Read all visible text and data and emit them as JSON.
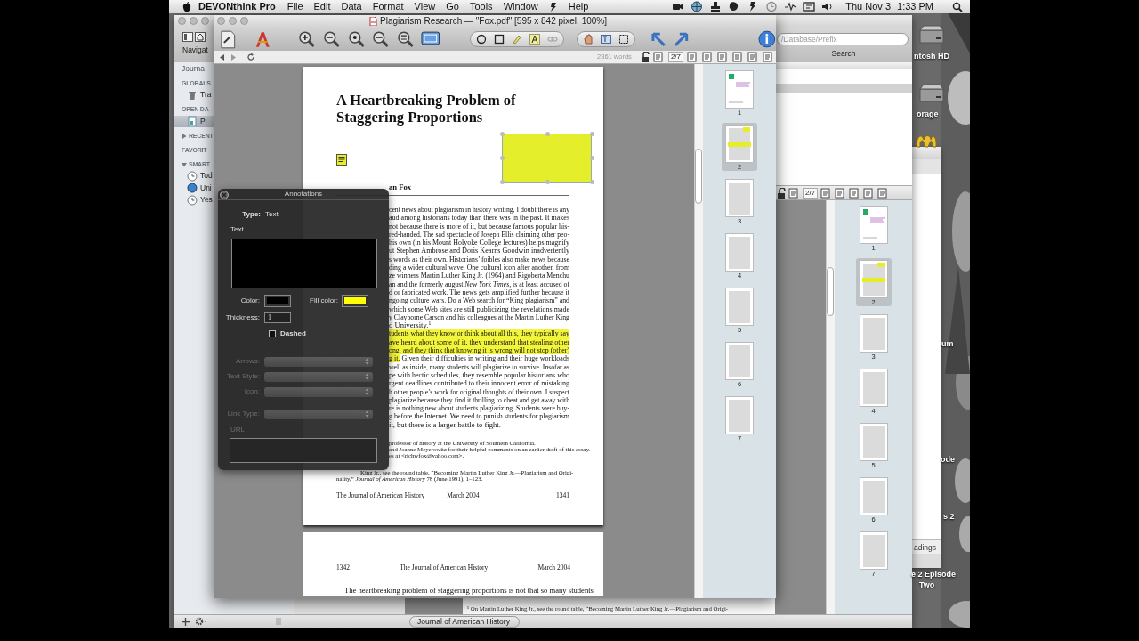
{
  "menu_bar": {
    "app_name": "DEVONthink Pro",
    "menus": [
      "File",
      "Edit",
      "Data",
      "Format",
      "View",
      "Go",
      "Tools",
      "Window",
      "Help"
    ],
    "date": "Thu Nov 3",
    "time": "1:33 PM"
  },
  "main_window": {
    "toolbar_label": "Navigat",
    "search": {
      "placeholder": "/Database/Prefix",
      "label": "Search"
    },
    "sidebar": [
      {
        "kind": "tab",
        "label": "Journa"
      },
      {
        "kind": "section",
        "label": "GLOBALS"
      },
      {
        "kind": "trash",
        "label": "Tra",
        "selected": false
      },
      {
        "kind": "section",
        "label": "OPEN DA"
      },
      {
        "kind": "database",
        "label": "Pl",
        "selected": true
      },
      {
        "kind": "section",
        "label": "RECENT",
        "expanded": false
      },
      {
        "kind": "section",
        "label": "FAVORIT"
      },
      {
        "kind": "section",
        "label": "SMART",
        "expanded": true
      },
      {
        "kind": "clock",
        "label": "Tod",
        "selected": false
      },
      {
        "kind": "unread",
        "label": "Uni",
        "selected": false
      },
      {
        "kind": "clock",
        "label": "Yes",
        "selected": false
      }
    ],
    "page_indicator": "2/7",
    "thumbnails": [
      {
        "label": "1",
        "kind": "cover",
        "selected": false
      },
      {
        "label": "2",
        "kind": "annotated",
        "selected": true
      },
      {
        "label": "3",
        "kind": "text",
        "selected": false
      },
      {
        "label": "4",
        "kind": "text",
        "selected": false
      },
      {
        "label": "5",
        "kind": "text",
        "selected": false
      },
      {
        "label": "6",
        "kind": "text",
        "selected": false
      },
      {
        "label": "7",
        "kind": "text",
        "selected": false
      }
    ],
    "preview_footnote": "¹ On Martin Luther King Jr., see the round table, “Becoming Martin Luther King Jr.—Plagiarism and Origi-",
    "tag": "Journal of American History"
  },
  "document_window": {
    "title": "Plagiarism Research — \"Fox.pdf\" [595 x 842 pixel, 100%]",
    "word_count": "2361 words",
    "page_indicator": "2/7",
    "page": {
      "title_lines": [
        "A Heartbreaking Problem of",
        "Staggering Proportions"
      ],
      "author": "an Fox",
      "body_lines": [
        {
          "segments": [
            {
              "text": "cent news about plagiarism in history writing, I doubt there is any",
              "highlighted": false
            }
          ]
        },
        {
          "segments": [
            {
              "text": "aud among historians today than there was in the past. It makes",
              "highlighted": false
            }
          ]
        },
        {
          "segments": [
            {
              "text": "not because there is more of it, but because famous popular his-",
              "highlighted": false
            }
          ]
        },
        {
          "segments": [
            {
              "text": "red-handed. The sad spectacle of Joseph Ellis claiming other peo-",
              "highlighted": false
            }
          ]
        },
        {
          "segments": [
            {
              "text": "his own (in his Mount Holyoke College lectures) helps magnify",
              "highlighted": false
            }
          ]
        },
        {
          "segments": [
            {
              "text": "ut Stephen Ambrose and Doris Kearns Goodwin inadvertently",
              "highlighted": false
            }
          ]
        },
        {
          "segments": [
            {
              "text": "s words as their own. Historians’ foibles also make news because",
              "highlighted": false
            }
          ]
        },
        {
          "segments": [
            {
              "text": "ding a wider cultural wave. One cultural icon after another, from",
              "highlighted": false
            }
          ]
        },
        {
          "segments": [
            {
              "text": "ze winners Martin Luther King Jr. (1964) and Rigoberta Menchu",
              "highlighted": false
            }
          ]
        },
        {
          "segments": [
            {
              "text": "an and the formerly august *New York Times,* is at least accused of",
              "highlighted": false
            }
          ]
        },
        {
          "segments": [
            {
              "text": "d or fabricated work. The news gets amplified further because it",
              "highlighted": false
            }
          ]
        },
        {
          "segments": [
            {
              "text": "ngoing culture wars. Do a Web search for “King plagiarism” and",
              "highlighted": false
            }
          ]
        },
        {
          "segments": [
            {
              "text": "which some Web sites are still publicizing the revelations made",
              "highlighted": false
            }
          ]
        },
        {
          "segments": [
            {
              "text": "y Clayborne Carson and his colleagues at the Martin Luther King",
              "highlighted": false
            }
          ]
        },
        {
          "segments": [
            {
              "text": "d University.$^{1}$",
              "highlighted": false
            }
          ]
        },
        {
          "segments": [
            {
              "text": "tudents what they know or think about all this, they typically say",
              "highlighted": true
            }
          ]
        },
        {
          "segments": [
            {
              "text": "ave heard about some of it, they understand that stealing other",
              "highlighted": true
            }
          ]
        },
        {
          "segments": [
            {
              "text": "ong, and they think that knowing it is wrong will not stop (other)",
              "highlighted": true
            }
          ]
        },
        {
          "segments": [
            {
              "text": "g it.",
              "highlighted": true
            },
            {
              "text": " Given their difficulties in writing and their huge workloads",
              "highlighted": false
            }
          ]
        },
        {
          "segments": [
            {
              "text": "well as inside, many students will plagiarize to survive. Insofar as",
              "highlighted": false
            }
          ]
        },
        {
          "segments": [
            {
              "text": "pe with hectic schedules, they resemble popular historians who",
              "highlighted": false
            }
          ]
        },
        {
          "segments": [
            {
              "text": "rgent deadlines contributed to their innocent error of mistaking",
              "highlighted": false
            }
          ]
        },
        {
          "segments": [
            {
              "text": "h other people’s work for original thoughts of their own. I suspect",
              "highlighted": false
            }
          ]
        },
        {
          "segments": [
            {
              "text": "plagiarize because they find it thrilling to cheat and get away with",
              "highlighted": false
            }
          ]
        },
        {
          "segments": [
            {
              "text": "re is nothing new about students plagiarizing. Students were buy-",
              "highlighted": false
            }
          ]
        },
        {
          "segments": [
            {
              "text": "g before the Internet. We need to punish students for plagiarism",
              "highlighted": false
            }
          ]
        },
        {
          "segments": [
            {
              "text": "it, but there is a larger battle to fight.",
              "highlighted": false
            }
          ]
        }
      ],
      "footnotes": [
        {
          "kind": "covered",
          "text": "professor of history at the University of Southern California."
        },
        {
          "kind": "covered",
          "text": "and Joanne Meyerowitz for their helpful comments on an earlier draft of this essay."
        },
        {
          "kind": "covered",
          "text": "es at <richwfox@yahoo.com>."
        },
        {
          "kind": "partial",
          "text": "King Jr., see the round table, “Becoming Martin Luther King Jr.—Plagiarism and Origi-"
        },
        {
          "kind": "full",
          "text": "nality,” *Journal of American History* 78 (June 1991), 1–123."
        }
      ],
      "footer": {
        "journal": "The Journal of American History",
        "date": "March 2004",
        "page_number": "1341"
      }
    },
    "next_page": {
      "page_number": "1342",
      "journal": "The Journal of American History",
      "date": "March 2004",
      "first_line": "The heartbreaking problem of staggering proportions is not that so many students"
    },
    "thumbnails": [
      {
        "label": "1",
        "kind": "cover",
        "selected": false
      },
      {
        "label": "2",
        "kind": "annotated",
        "selected": true
      },
      {
        "label": "3",
        "kind": "text",
        "selected": false
      },
      {
        "label": "4",
        "kind": "text",
        "selected": false
      },
      {
        "label": "5",
        "kind": "text",
        "selected": false
      },
      {
        "label": "6",
        "kind": "text",
        "selected": false
      },
      {
        "label": "7",
        "kind": "text",
        "selected": false
      }
    ]
  },
  "annotations_panel": {
    "title": "Annotations",
    "type_label": "Type:",
    "type_value": "Text",
    "text_label": "Text",
    "swatches": [
      {
        "label": "Color:",
        "color": "#000000"
      },
      {
        "label": "Fill color:",
        "color": "#ffff00"
      }
    ],
    "thickness_label": "Thickness:",
    "thickness": "1",
    "dashed": {
      "label": "Dashed",
      "checked": false
    },
    "popups": [
      {
        "label": "Arrows:",
        "disabled": true
      },
      {
        "label": "Text Style:",
        "disabled": true
      },
      {
        "label": "Icon:",
        "disabled": true
      },
      {
        "label": "Link Type:",
        "disabled": true
      }
    ],
    "url_label": "URL"
  },
  "side_window": {
    "label": "adings"
  },
  "desktop_labels": [
    "ntosh HD",
    "orage",
    "um",
    "ode",
    "s 2",
    "e 2 Episode",
    "Two"
  ]
}
